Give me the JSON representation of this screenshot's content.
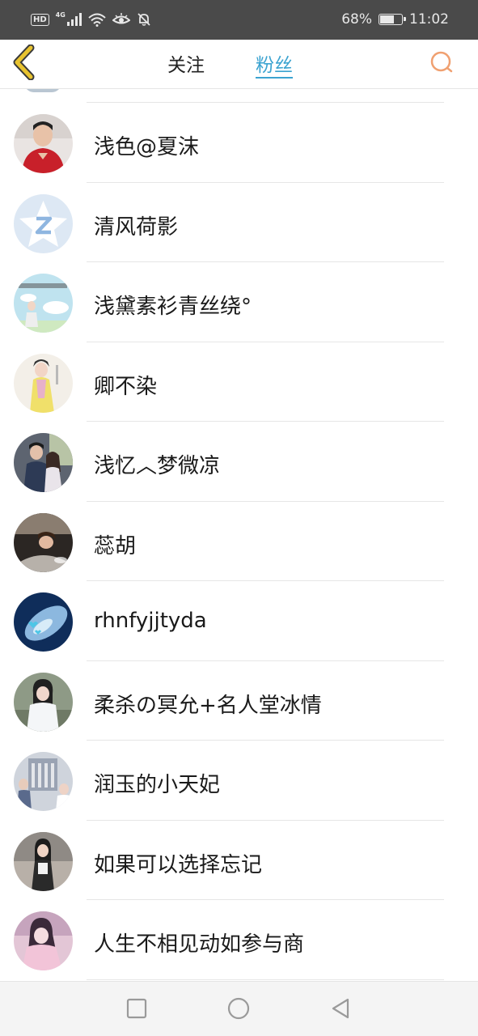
{
  "status_bar": {
    "hd_label": "HD",
    "network_label": "4G",
    "battery_percent": "68%",
    "battery_level": 0.68,
    "time": "11:02"
  },
  "header": {
    "tabs": [
      {
        "label": "关注",
        "active": false
      },
      {
        "label": "粉丝",
        "active": true
      }
    ],
    "accent_color": "#3ba3d0",
    "back_icon_color": "#e8c32f",
    "search_icon_color": "#f0a070"
  },
  "fans": [
    {
      "name": "浅色@夏沫",
      "avatar_icon": "man-red-shirt-avatar"
    },
    {
      "name": "清风荷影",
      "avatar_icon": "qzone-star-avatar"
    },
    {
      "name": "浅黛素衫青丝绕°",
      "avatar_icon": "anime-girl-sky-avatar"
    },
    {
      "name": "卿不染",
      "avatar_icon": "costume-lady-avatar"
    },
    {
      "name": "浅忆︿梦微凉",
      "avatar_icon": "couple-avatar"
    },
    {
      "name": "蕊胡",
      "avatar_icon": "car-driver-avatar"
    },
    {
      "name": "rhnfyjjtyda",
      "avatar_icon": "blue-hearts-avatar"
    },
    {
      "name": "柔杀の冥允+名人堂冰情",
      "avatar_icon": "white-dress-lady-avatar"
    },
    {
      "name": "润玉的小天妃",
      "avatar_icon": "palace-scene-avatar"
    },
    {
      "name": "如果可以选择忘记",
      "avatar_icon": "girl-standing-avatar"
    },
    {
      "name": "人生不相见动如参与商",
      "avatar_icon": "pink-lady-avatar"
    }
  ]
}
